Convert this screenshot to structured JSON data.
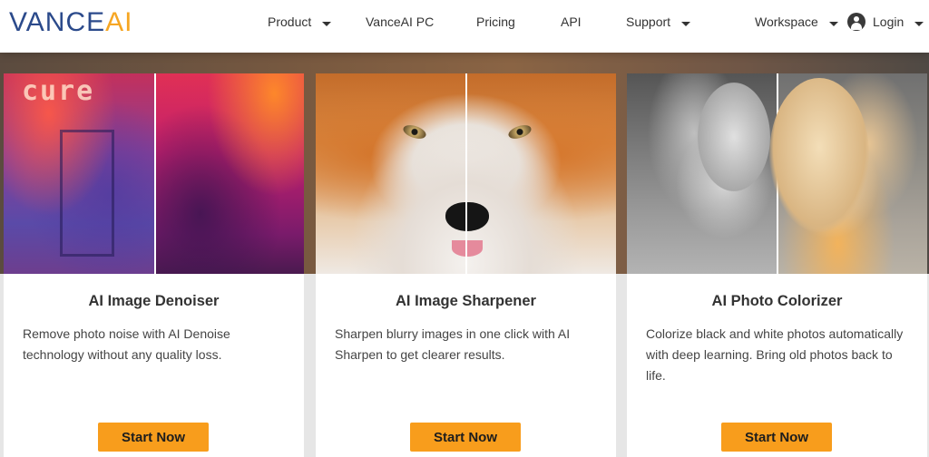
{
  "brand": {
    "logo_part1": "VANCE",
    "logo_part2": "AI",
    "logo_color_primary": "#2b4a8b",
    "logo_color_accent": "#f6a623"
  },
  "nav": {
    "product": "Product",
    "pc": "VanceAI PC",
    "pricing": "Pricing",
    "api": "API",
    "support": "Support",
    "workspace": "Workspace",
    "login": "Login"
  },
  "cards": [
    {
      "title": "AI Image Denoiser",
      "description": "Remove photo noise with AI Denoise technology without any quality loss.",
      "button": "Start Now",
      "image_alt": "denoiser-before-after",
      "sign_text": "cure"
    },
    {
      "title": "AI Image Sharpener",
      "description": "Sharpen blurry images in one click with AI Sharpen to get clearer results.",
      "button": "Start Now",
      "image_alt": "fox-before-after"
    },
    {
      "title": "AI Photo Colorizer",
      "description": "Colorize black and white photos automatically with deep learning. Bring old photos back to life.",
      "button": "Start Now",
      "image_alt": "woman-before-after"
    }
  ],
  "colors": {
    "button_bg": "#f89d1c",
    "card_bg": "#ffffff",
    "page_bg": "#e6e6e6"
  }
}
